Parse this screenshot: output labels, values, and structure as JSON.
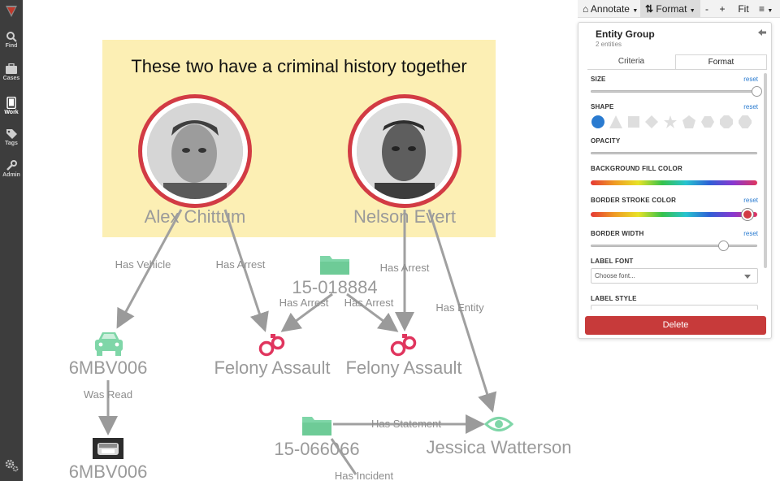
{
  "rail": {
    "items": [
      {
        "label": "Find",
        "icon": "search-icon"
      },
      {
        "label": "Cases",
        "icon": "briefcase-icon"
      },
      {
        "label": "Work",
        "icon": "tablet-icon",
        "active": true
      },
      {
        "label": "Tags",
        "icon": "tag-icon"
      },
      {
        "label": "Admin",
        "icon": "wrench-icon"
      }
    ],
    "bottom_icon": "gears-icon"
  },
  "graph": {
    "note_text": "These two have a criminal history together",
    "people": [
      {
        "name": "Alex Chittum",
        "icon": "portrait"
      },
      {
        "name": "Nelson Evert",
        "icon": "portrait"
      }
    ],
    "cases": [
      {
        "name": "15-018884",
        "icon": "folder-icon"
      },
      {
        "name": "15-066066",
        "icon": "folder-icon"
      }
    ],
    "arrests": [
      {
        "name": "Felony Assault",
        "icon": "handcuffs-icon"
      },
      {
        "name": "Felony Assault",
        "icon": "handcuffs-icon"
      }
    ],
    "vehicles": [
      {
        "name": "6MBV006",
        "icon": "car-icon"
      },
      {
        "name": "6MBV006",
        "icon": "license-plate-photo"
      }
    ],
    "witness": {
      "name": "Jessica Watterson",
      "icon": "eye-icon"
    },
    "edges": [
      "Has Vehicle",
      "Has Arrest",
      "Has Arrest",
      "Has Arrest",
      "Has Arrest",
      "Has Entity",
      "Was Read",
      "Has Statement",
      "Has Incident"
    ]
  },
  "toolbar": {
    "annotate": "Annotate",
    "format": "Format",
    "minus": "-",
    "plus": "+",
    "fit": "Fit"
  },
  "panel": {
    "title": "Entity Group",
    "subtitle": "2 entities",
    "tabs": [
      "Criteria",
      "Format"
    ],
    "active_tab": "Format",
    "size_label": "SIZE",
    "shape_label": "SHAPE",
    "opacity_label": "OPACITY",
    "bg_fill_label": "BACKGROUND FILL COLOR",
    "border_stroke_label": "BORDER STROKE COLOR",
    "border_width_label": "BORDER WIDTH",
    "label_font_label": "LABEL FONT",
    "label_style_label": "LABEL STYLE",
    "reset": "reset",
    "font_placeholder": "Choose font...",
    "delete_label": "Delete",
    "size_value": 1.0,
    "border_width_value": 0.8,
    "border_stroke_color": "#d23b44",
    "selected_shape": "circle",
    "shapes": [
      "circle",
      "triangle",
      "square",
      "diamond",
      "star",
      "pentagon",
      "hexagon",
      "octagon",
      "rounded-hexagon"
    ]
  },
  "colors": {
    "accent_blue": "#2a7bd0",
    "node_green": "#7fd6a8",
    "arrest_red": "#e0355e",
    "border_red": "#d23b44",
    "delete_red": "#c73a3a",
    "note_yellow": "#fcefb4"
  }
}
